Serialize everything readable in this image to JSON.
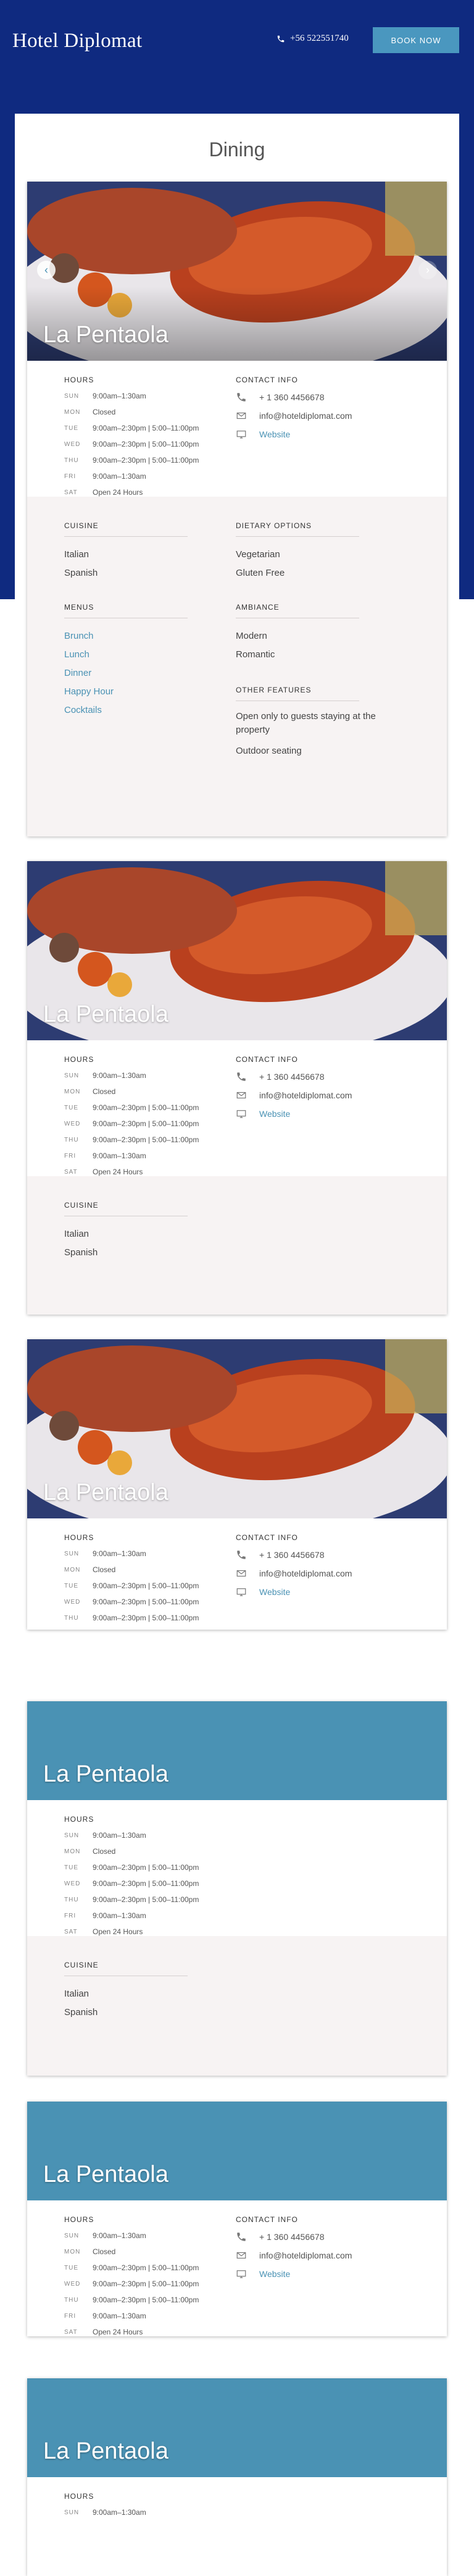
{
  "header": {
    "brand": "Hotel Diplomat",
    "phone": "+56 522551740",
    "book_label": "BOOK NOW"
  },
  "page": {
    "title": "Dining"
  },
  "restaurant": {
    "name": "La Pentaola",
    "hours_label": "HOURS",
    "contact_label": "CONTACT INFO",
    "hours": [
      {
        "day": "SUN",
        "time": "9:00am–1:30am"
      },
      {
        "day": "MON",
        "time": "Closed"
      },
      {
        "day": "TUE",
        "time": "9:00am–2:30pm | 5:00–11:00pm"
      },
      {
        "day": "WED",
        "time": "9:00am–2:30pm | 5:00–11:00pm"
      },
      {
        "day": "THU",
        "time": "9:00am–2:30pm | 5:00–11:00pm"
      },
      {
        "day": "FRI",
        "time": "9:00am–1:30am"
      },
      {
        "day": "SAT",
        "time": "Open 24 Hours"
      }
    ],
    "contact": {
      "phone": "+ 1 360 4456678",
      "email": "info@hoteldiplomat.com",
      "website": "Website"
    },
    "cuisine_label": "CUISINE",
    "cuisine": [
      "Italian",
      "Spanish"
    ],
    "dietary_label": "DIETARY OPTIONS",
    "dietary": [
      "Vegetarian",
      "Gluten Free"
    ],
    "menus_label": "MENUS",
    "menus": [
      "Brunch",
      "Lunch",
      "Dinner",
      "Happy Hour",
      "Cocktails"
    ],
    "ambiance_label": "AMBIANCE",
    "ambiance": [
      "Modern",
      "Romantic"
    ],
    "features_label": "OTHER FEATURES",
    "features": [
      "Open only to guests staying at the property",
      "Outdoor seating"
    ]
  },
  "colors": {
    "header_bg": "#0f2a80",
    "accent": "#4a92b4",
    "details_bg": "#f7f3f3"
  }
}
